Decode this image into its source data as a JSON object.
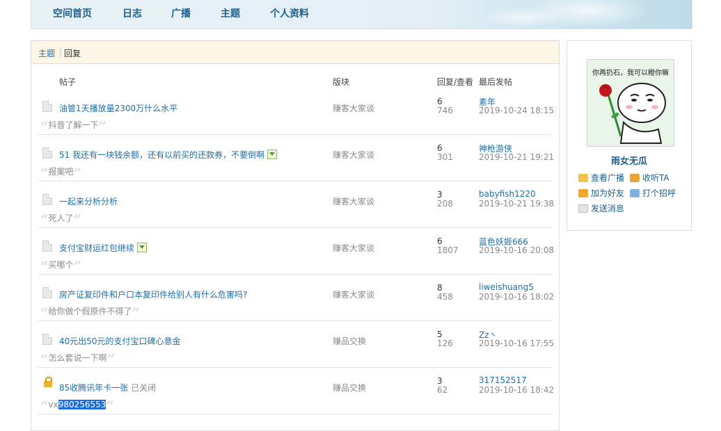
{
  "nav": {
    "items": [
      "空间首页",
      "日志",
      "广播",
      "主题",
      "个人资料"
    ]
  },
  "breadcrumb": {
    "items": [
      "主题",
      "回复"
    ],
    "separator": "|"
  },
  "table": {
    "headers": {
      "post": "帖子",
      "forum": "版块",
      "replies_views": "回复/查看",
      "last_post": "最后发帖"
    },
    "rows": [
      {
        "title": "油管1天播放量2300万什么水平",
        "has_image": false,
        "locked": false,
        "closed_label": "",
        "forum": "赚客大家谈",
        "replies": "6",
        "views": "746",
        "last_user": "素年",
        "last_date": "2019-10-24 18:15",
        "quote": "抖音了解一下",
        "quote_highlight": ""
      },
      {
        "title": "51 我还有一块钱余额，还有以前买的还款券，不要倒啊",
        "has_image": true,
        "locked": false,
        "closed_label": "",
        "forum": "赚客大家谈",
        "replies": "6",
        "views": "301",
        "last_user": "神枪游侠",
        "last_date": "2019-10-21 19:21",
        "quote": "报案吧",
        "quote_highlight": ""
      },
      {
        "title": "一起来分析分析",
        "has_image": false,
        "locked": false,
        "closed_label": "",
        "forum": "赚客大家谈",
        "replies": "3",
        "views": "208",
        "last_user": "babyfish1220",
        "last_date": "2019-10-21 19:38",
        "quote": "死人了",
        "quote_highlight": ""
      },
      {
        "title": "支付宝财运红包继续",
        "has_image": true,
        "locked": false,
        "closed_label": "",
        "forum": "赚客大家谈",
        "replies": "6",
        "views": "1807",
        "last_user": "蓝色妖姬666",
        "last_date": "2019-10-16 20:08",
        "quote": "买哪个",
        "quote_highlight": ""
      },
      {
        "title": "房产证复印件和户口本复印件给别人有什么危害吗?",
        "has_image": false,
        "locked": false,
        "closed_label": "",
        "forum": "赚客大家谈",
        "replies": "8",
        "views": "458",
        "last_user": "liweishuang5",
        "last_date": "2019-10-16 18:02",
        "quote": "给你做个假原件不得了",
        "quote_highlight": ""
      },
      {
        "title": "40元出50元的支付宝口碑心意金",
        "has_image": false,
        "locked": false,
        "closed_label": "",
        "forum": "赚品交换",
        "replies": "5",
        "views": "126",
        "last_user": "Zz丶",
        "last_date": "2019-10-16 17:55",
        "quote": "怎么套说一下啊",
        "quote_highlight": ""
      },
      {
        "title": "85收腾讯年卡一张",
        "has_image": false,
        "locked": true,
        "closed_label": "已关闭",
        "forum": "赚品交换",
        "replies": "3",
        "views": "62",
        "last_user": "317152517",
        "last_date": "2019-10-16 18:42",
        "quote": "vx",
        "quote_highlight": "980256553"
      }
    ]
  },
  "profile": {
    "avatar_caption": "你再扔石，我可以瞪你嘛",
    "username": "雨女无瓜",
    "actions": [
      "查看广播",
      "收听TA",
      "加为好友",
      "打个招呼",
      "发送消息"
    ]
  },
  "colors": {
    "link": "#1f6fa8",
    "nav": "#1f5f8b",
    "breadcrumb_bg": "#fbf6e5",
    "highlight": "#1e6fd9"
  }
}
